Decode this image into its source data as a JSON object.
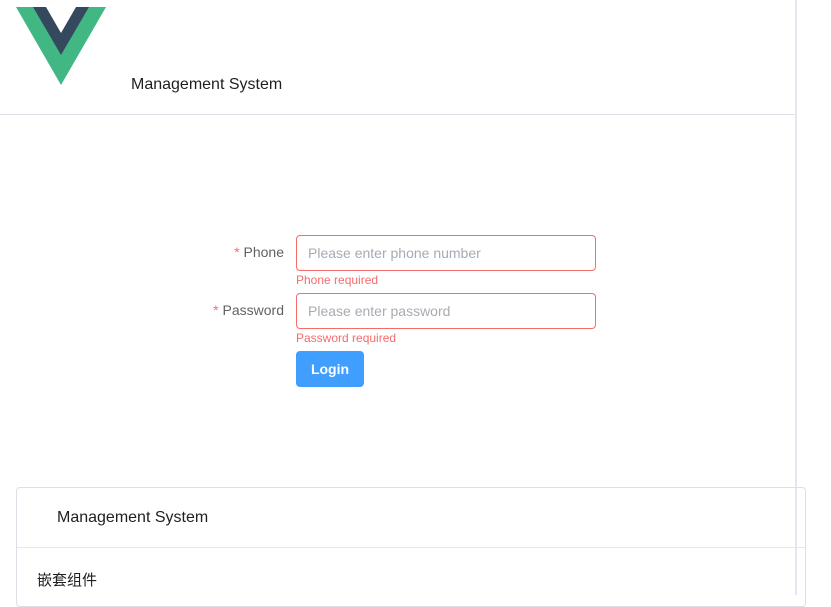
{
  "header": {
    "logo_icon": "vue-logo-icon",
    "title": "Management System"
  },
  "form": {
    "phone": {
      "label": "Phone",
      "required_mark": "*",
      "placeholder": "Please enter phone number",
      "value": "",
      "error": "Phone required"
    },
    "password": {
      "label": "Password",
      "required_mark": "*",
      "placeholder": "Please enter password",
      "value": "",
      "error": "Password required"
    },
    "login_label": "Login"
  },
  "card": {
    "title": "Management System",
    "body": "嵌套组件"
  },
  "colors": {
    "primary": "#409eff",
    "error": "#f56c6c",
    "logo_green": "#41b883",
    "logo_dark": "#35495e"
  }
}
